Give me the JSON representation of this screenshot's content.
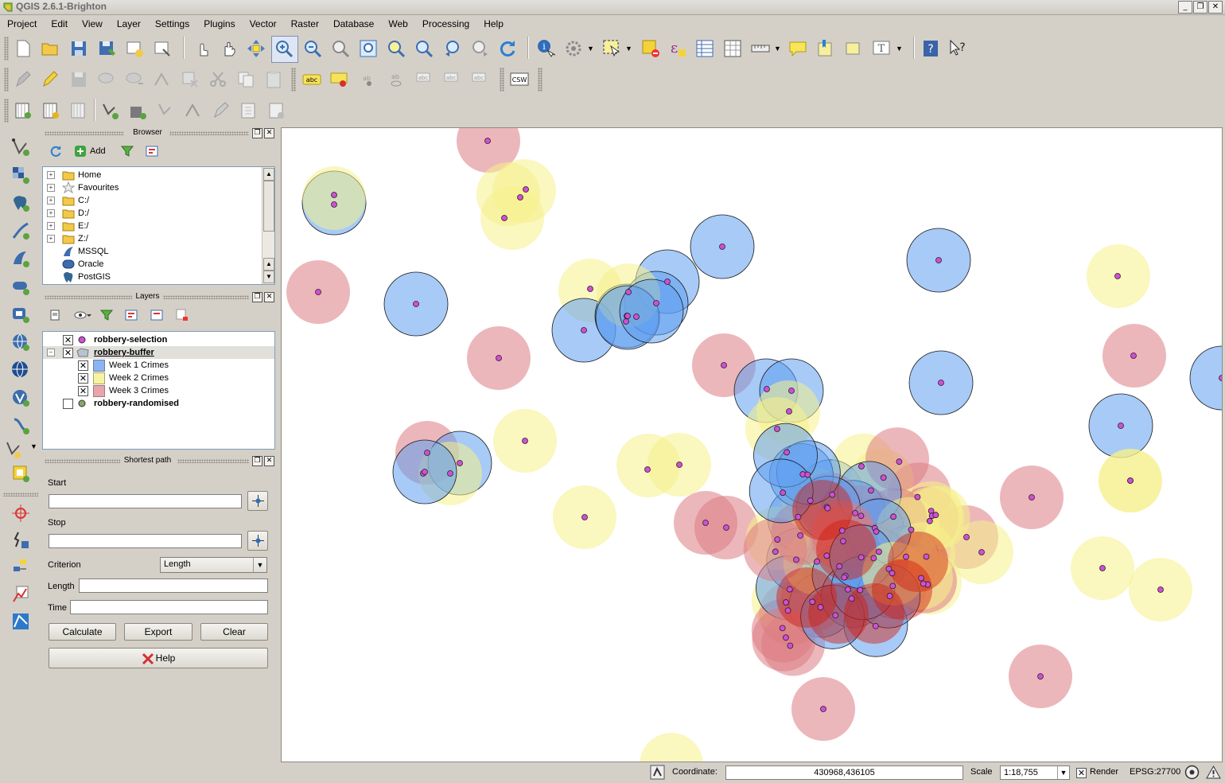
{
  "window": {
    "title": "QGIS 2.6.1-Brighton",
    "controls": [
      "_",
      "❐",
      "✕"
    ]
  },
  "menu": [
    "Project",
    "Edit",
    "View",
    "Layer",
    "Settings",
    "Plugins",
    "Vector",
    "Raster",
    "Database",
    "Web",
    "Processing",
    "Help"
  ],
  "browser": {
    "title": "Browser",
    "add_label": "Add",
    "items": [
      "Home",
      "Favourites",
      "C:/",
      "D:/",
      "E:/",
      "Z:/",
      "MSSQL",
      "Oracle",
      "PostGIS"
    ]
  },
  "layers": {
    "title": "Layers",
    "items": [
      {
        "name": "robbery-selection",
        "checked": true
      },
      {
        "name": "robbery-buffer",
        "checked": true
      },
      {
        "name": "robbery-randomised",
        "checked": false
      }
    ],
    "legend": [
      {
        "name": "Week 1 Crimes",
        "color": "#8ab4f3"
      },
      {
        "name": "Week 2 Crimes",
        "color": "#f8f3a0"
      },
      {
        "name": "Week 3 Crimes",
        "color": "#e8a6aa"
      }
    ]
  },
  "shortest_path": {
    "title": "Shortest path",
    "start_label": "Start",
    "stop_label": "Stop",
    "criterion_label": "Criterion",
    "criterion_value": "Length",
    "length_label": "Length",
    "time_label": "Time",
    "calculate_label": "Calculate",
    "export_label": "Export",
    "clear_label": "Clear",
    "help_label": "Help"
  },
  "toolbar_text": {
    "label_tool": "abc",
    "csw": "CSW"
  },
  "status": {
    "coordinate_label": "Coordinate:",
    "coordinate_value": "430968,436105",
    "scale_label": "Scale",
    "scale_value": "1:18,755",
    "render_label": "Render",
    "render_checked": true,
    "crs": "EPSG:27700"
  },
  "colors": {
    "week1": "#5e9ef0",
    "week2": "#f6f08a",
    "week3": "#dd7b82",
    "point": "#d24ed6"
  }
}
